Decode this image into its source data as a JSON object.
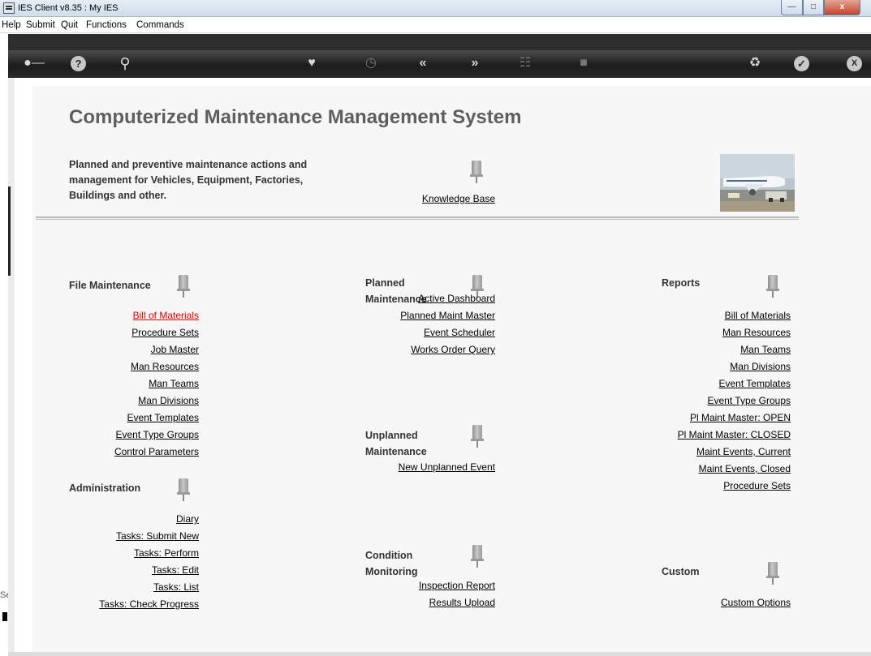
{
  "window": {
    "title": "IES Client v8.35 : My IES"
  },
  "menu": [
    "Help",
    "Submit",
    "Quit",
    "Functions",
    "Commands"
  ],
  "toolbar_icons": [
    "key-icon",
    "help-icon",
    "search-icon",
    "heart-icon",
    "clock-icon",
    "back-icon",
    "forward-icon",
    "filter-icon",
    "stop-icon",
    "recycle-icon",
    "check-icon",
    "close-icon"
  ],
  "page": {
    "title": "Computerized Maintenance Management System",
    "intro": "Planned and preventive maintenance actions and management for Vehicles, Equipment, Factories, Buildings and other.",
    "knowledge_base": "Knowledge Base"
  },
  "sections": {
    "file_maintenance": {
      "title": "File Maintenance",
      "links": [
        "Bill of Materials",
        "Procedure Sets",
        "Job Master",
        "Man Resources",
        "Man Teams",
        "Man Divisions",
        "Event Templates",
        "Event Type Groups",
        "Control Parameters"
      ],
      "active_index": 0
    },
    "administration": {
      "title": "Administration",
      "links": [
        "Diary",
        "Tasks: Submit New",
        "Tasks: Perform",
        "Tasks: Edit",
        "Tasks: List",
        "Tasks: Check Progress"
      ]
    },
    "planned_maintenance": {
      "title_line1": "Planned",
      "title_line2": "Maintenance",
      "links": [
        "Active Dashboard",
        "Planned Maint Master",
        "Event Scheduler",
        "Works Order Query"
      ]
    },
    "unplanned_maintenance": {
      "title_line1": "Unplanned",
      "title_line2": "Maintenance",
      "links": [
        "New Unplanned Event"
      ]
    },
    "condition_monitoring": {
      "title_line1": "Condition",
      "title_line2": "Monitoring",
      "links": [
        "Inspection Report",
        "Results Upload"
      ]
    },
    "reports": {
      "title": "Reports",
      "links": [
        "Bill of Materials",
        "Man Resources",
        "Man Teams",
        "Man Divisions",
        "Event Templates",
        "Event Type Groups",
        "Pl Maint Master: OPEN",
        "Pl Maint Master: CLOSED",
        "Maint Events, Current",
        "Maint Events, Closed",
        "Procedure Sets"
      ]
    },
    "custom": {
      "title": "Custom",
      "links": [
        "Custom Options"
      ]
    }
  },
  "status": {
    "session_label": "Ses"
  },
  "colors": {
    "active_link": "#dd0000",
    "title": "#5e5e5e",
    "toolbar": "#2a2a2a"
  }
}
